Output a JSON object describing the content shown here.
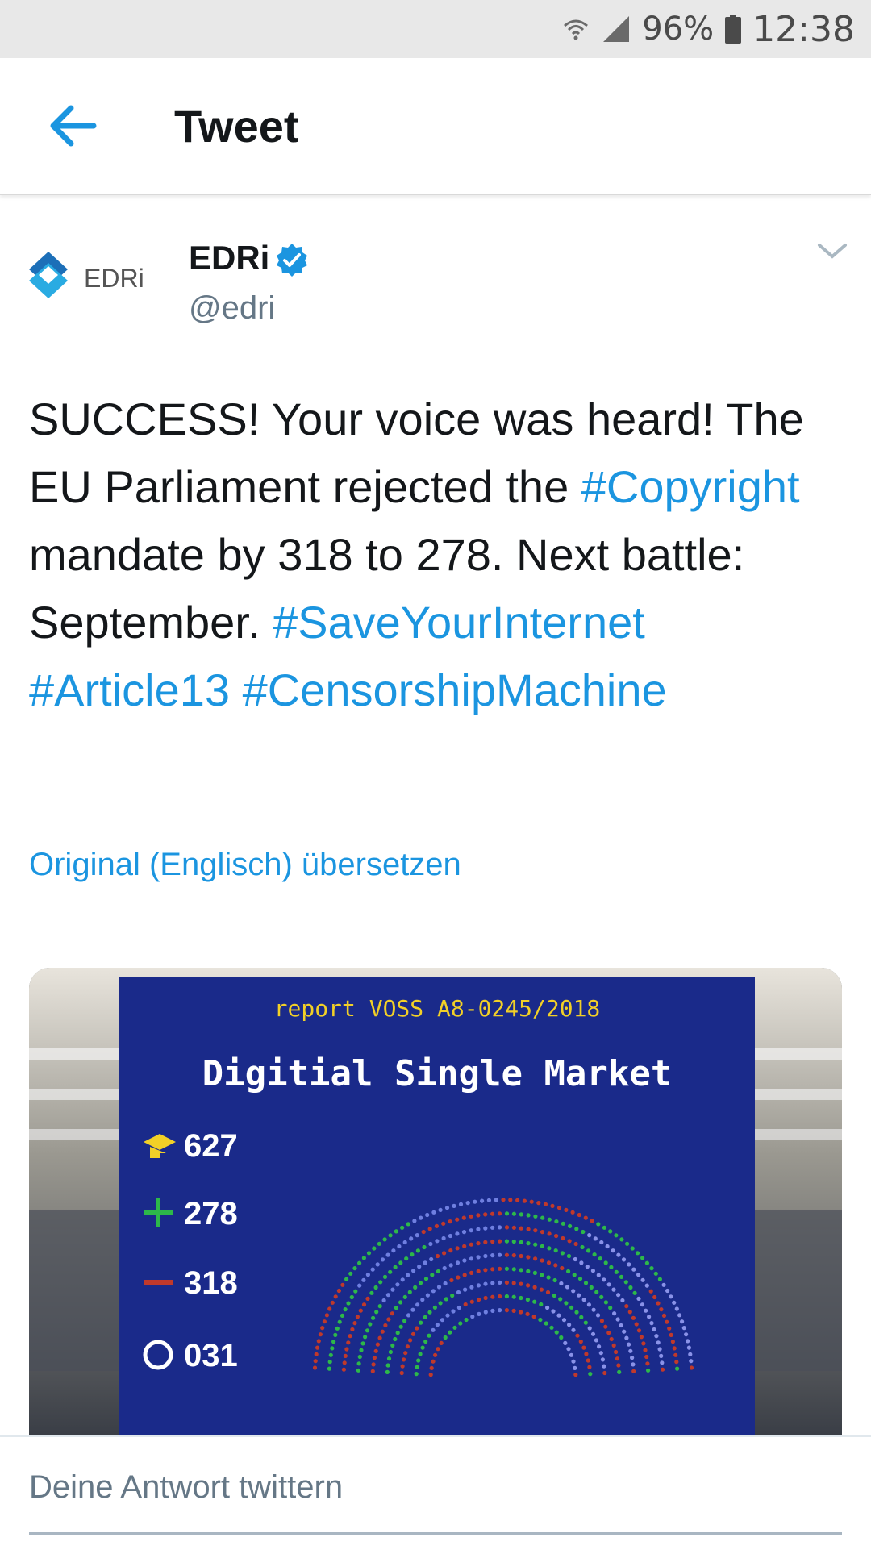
{
  "status_bar": {
    "battery": "96%",
    "time": "12:38"
  },
  "app_bar": {
    "title": "Tweet"
  },
  "tweet": {
    "author_name": "EDRi",
    "avatar_text": "EDRi",
    "handle": "@edri",
    "text_segments": [
      {
        "text": "SUCCESS! Your voice was heard! The EU Parliament rejected the ",
        "type": "text"
      },
      {
        "text": "#Copyright",
        "type": "hashtag"
      },
      {
        "text": " mandate by 318 to 278. Next battle: September. ",
        "type": "text"
      },
      {
        "text": "#SaveYourInternet",
        "type": "hashtag"
      },
      {
        "text": " ",
        "type": "text"
      },
      {
        "text": "#Article13",
        "type": "hashtag"
      },
      {
        "text": " ",
        "type": "text"
      },
      {
        "text": "#CensorshipMachine",
        "type": "hashtag"
      }
    ],
    "translate_link": "Original (Englisch) übersetzen",
    "media": {
      "report": "report VOSS A8-0245/2018",
      "title": "Digitial Single Market",
      "counts": [
        {
          "symbol": "present-icon",
          "value": "627",
          "color": "#f2d027"
        },
        {
          "symbol": "plus",
          "value": "278",
          "color": "#2db84a"
        },
        {
          "symbol": "minus",
          "value": "318",
          "color": "#c0392b"
        },
        {
          "symbol": "circle",
          "value": "031",
          "color": "#ffffff"
        }
      ]
    }
  },
  "reply": {
    "placeholder": "Deine Antwort twittern"
  },
  "colors": {
    "accent": "#1b95e0",
    "text": "#14171a",
    "secondary": "#657786"
  }
}
